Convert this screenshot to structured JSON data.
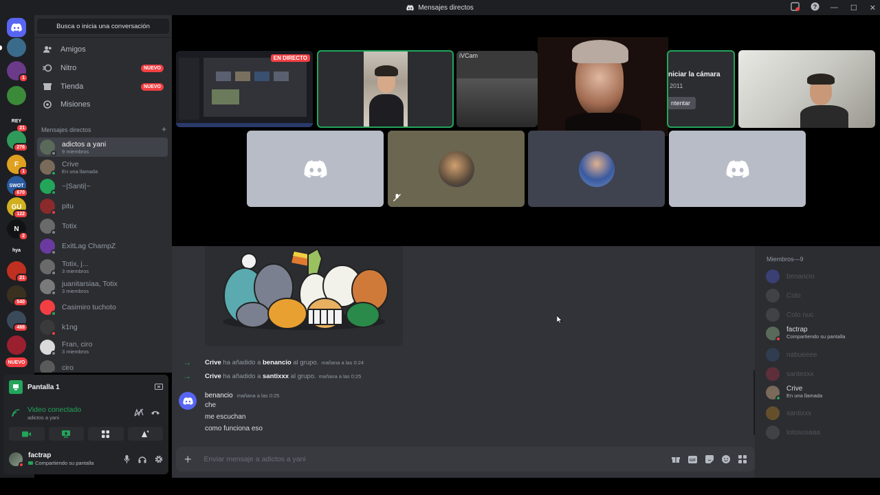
{
  "window": {
    "title": "Mensajes directos",
    "minimize": "—",
    "maximize": "☐",
    "close": "✕"
  },
  "servers": [
    {
      "label": "",
      "badge": "",
      "color": "#5865f2"
    },
    {
      "label": "",
      "badge": "",
      "color": "#3b6b8a"
    },
    {
      "label": "",
      "badge": "1",
      "color": "#6b3b8a"
    },
    {
      "label": "",
      "badge": "",
      "color": "#3a8a3a"
    },
    {
      "label": "REY",
      "badge": "21",
      "color": "#1e1f22"
    },
    {
      "label": "",
      "badge": "276",
      "color": "#2f9a5a"
    },
    {
      "label": "F",
      "badge": "1",
      "color": "#e0a020"
    },
    {
      "label": "SWOT",
      "badge": "670",
      "color": "#2a5aa0"
    },
    {
      "label": "GU",
      "badge": "122",
      "color": "#d0b020"
    },
    {
      "label": "N",
      "badge": "2",
      "color": "#111214"
    },
    {
      "label": "hya",
      "badge": "",
      "color": "#1e1f22"
    },
    {
      "label": "",
      "badge": "21",
      "color": "#c03020"
    },
    {
      "label": "",
      "badge": "540",
      "color": "#3a3020"
    },
    {
      "label": "",
      "badge": "488",
      "color": "#3a4a5a"
    },
    {
      "label": "",
      "badge": "",
      "color": "#9a2030"
    },
    {
      "label": "NUEVO",
      "badge": "",
      "color": "#f23f43"
    }
  ],
  "sidebar": {
    "search_label": "Busca o inicia una conversación",
    "nav": [
      {
        "label": "Amigos",
        "badge": ""
      },
      {
        "label": "Nitro",
        "badge": "NUEVO"
      },
      {
        "label": "Tienda",
        "badge": "NUEVO"
      },
      {
        "label": "Misiones",
        "badge": ""
      }
    ],
    "dm_header": "Mensajes directos",
    "dm_add": "+",
    "dms": [
      {
        "name": "adictos a yani",
        "sub": "9 miembros",
        "active": true,
        "color": "#5a6a5a"
      },
      {
        "name": "Crive",
        "sub": "En una llamada",
        "active": false,
        "color": "#7a6a5a"
      },
      {
        "name": "~|Santi|~",
        "sub": "",
        "active": false,
        "color": "#23a55a"
      },
      {
        "name": "pitu",
        "sub": "",
        "active": false,
        "color": "#8a2a2a"
      },
      {
        "name": "Totix",
        "sub": "",
        "active": false,
        "color": "#6a6a6a"
      },
      {
        "name": "ExitLag ChampZ",
        "sub": "",
        "active": false,
        "color": "#6a3aa0"
      },
      {
        "name": "Totix, j...",
        "sub": "3 miembros",
        "active": false,
        "color": "#6a6a6a"
      },
      {
        "name": "juanitarsiaa, Totix",
        "sub": "3 miembros",
        "active": false,
        "color": "#7a7a7a"
      },
      {
        "name": "Casimiro tuchoto",
        "sub": "",
        "active": false,
        "color": "#f23f43"
      },
      {
        "name": "k1ng",
        "sub": "",
        "active": false,
        "color": "#3a3a3a"
      },
      {
        "name": "Fran, ciro",
        "sub": "3 miembros",
        "active": false,
        "color": "#dadada"
      },
      {
        "name": "ciro",
        "sub": "",
        "active": false,
        "color": "#5a5a5a"
      }
    ]
  },
  "panel": {
    "screen_title": "Pantalla 1",
    "voice_status": "Video conectado",
    "voice_channel": "adictos a yani",
    "user_name": "factrap",
    "user_status": "Compartiendo su pantalla"
  },
  "call": {
    "live_badge": "EN DIRECTO",
    "ivcam_label": "iVCam",
    "camera_text": "niciar la cámara",
    "camera_sub": "2011",
    "camera_btn": "ntentar"
  },
  "chat": {
    "system_messages": [
      {
        "actor": "Crive",
        "verb": "ha añadido a",
        "target": "benancio",
        "suffix": "al grupo.",
        "time": "mañana a las 0:24"
      },
      {
        "actor": "Crive",
        "verb": "ha añadido a",
        "target": "santixxx",
        "suffix": "al grupo.",
        "time": "mañana a las 0:25"
      }
    ],
    "message": {
      "author": "benancio",
      "time": "mañana a las 0:25",
      "lines": [
        "che",
        "me escuchan",
        "como funciona eso"
      ]
    },
    "composer_placeholder": "Enviar mensaje a adictos a yani"
  },
  "members": {
    "header": "Miembros—9",
    "list": [
      {
        "name": "benancio",
        "status": "",
        "dim": true,
        "color": "#5865f2"
      },
      {
        "name": "Colo",
        "status": "",
        "dim": true,
        "color": "#6a6a6a"
      },
      {
        "name": "Colo nuc",
        "status": "",
        "dim": true,
        "color": "#6a6a6a"
      },
      {
        "name": "factrap",
        "status": "Compartiendo su pantalla",
        "dim": false,
        "color": "#5a6a5a"
      },
      {
        "name": "nabueeee",
        "status": "",
        "dim": true,
        "color": "#3a5a8a"
      },
      {
        "name": "santexxx",
        "status": "",
        "dim": true,
        "color": "#c03050"
      },
      {
        "name": "Crive",
        "status": "En una llamada",
        "dim": false,
        "color": "#7a6a5a"
      },
      {
        "name": "santixxx",
        "status": "",
        "dim": true,
        "color": "#d09020"
      },
      {
        "name": "totososaaa",
        "status": "",
        "dim": true,
        "color": "#6a6a6a"
      }
    ]
  }
}
